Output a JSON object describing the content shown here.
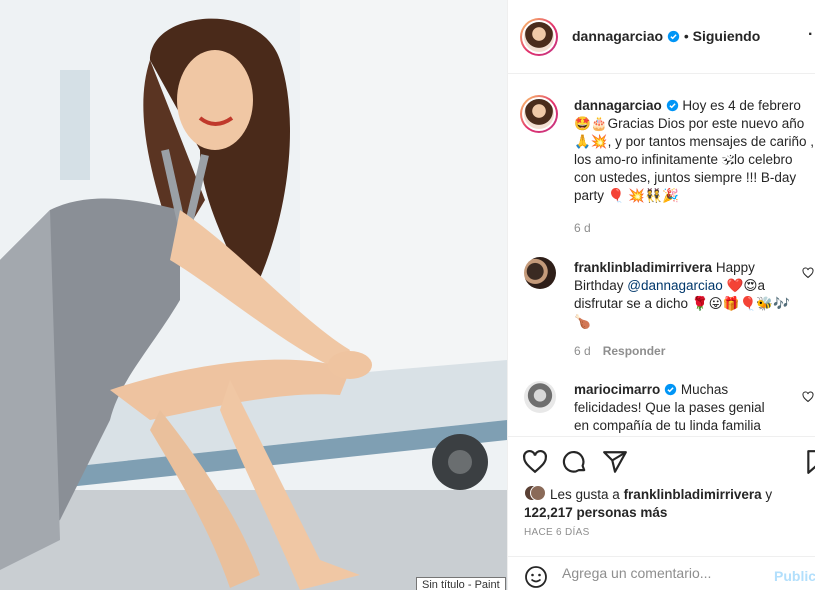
{
  "post_author": {
    "username": "dannagarciao",
    "follow_status": "Siguiendo",
    "separator": "•"
  },
  "caption": {
    "username": "dannagarciao",
    "text": "Hoy es 4 de febrero 🤩🎂Gracias Dios por este nuevo año 🙏💥, y por tantos mensajes de cariño , los amo-ro infinitamente 🕉lo celebro con ustedes, juntos siempre !!! B-day party 🎈 💥👯🎉",
    "time": "6 d"
  },
  "comments": [
    {
      "username": "franklinbladimirrivera",
      "text_before": "Happy Birthday ",
      "mention": "@dannagarciao",
      "text_after": " ❤️😍a disfrutar se a dicho 🌹😛🎁🎈🐝🎶🍗",
      "time": "6 d",
      "reply_label": "Responder"
    },
    {
      "username": "mariocimarro",
      "text": "Muchas felicidades! Que la pases genial en compañía de tu linda familia"
    }
  ],
  "likes": {
    "prefix": "Les gusta a ",
    "user": "franklinbladimirrivera",
    "conj": " y",
    "count_text": "122,217 personas más"
  },
  "time_ago": "HACE 6 DÍAS",
  "composer": {
    "placeholder": "Agrega un comentario...",
    "publish_label": "Publicar"
  },
  "taskbar_tooltip": "Sin título - Paint",
  "icons": {
    "like": "heart-icon",
    "comment": "comment-icon",
    "share": "share-icon",
    "save": "bookmark-icon",
    "emoji": "emoji-icon",
    "more": "more-options-icon",
    "verified": "verified-badge-icon"
  },
  "colors": {
    "verified_blue": "#0095f6",
    "link_blue": "#00376b",
    "publish_disabled": "#b2dffc",
    "muted_text": "#8e8e8e"
  }
}
